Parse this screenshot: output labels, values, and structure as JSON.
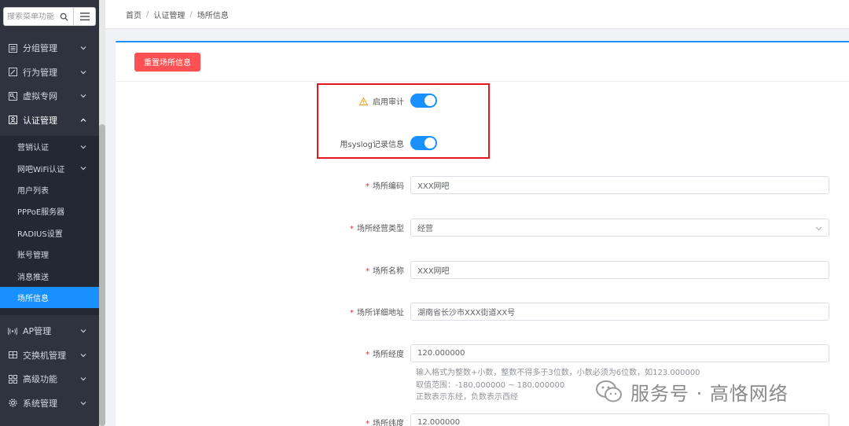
{
  "sidebar": {
    "search_placeholder": "搜索菜单功能",
    "top_items": [
      {
        "label": "分组管理",
        "icon": "list-icon"
      },
      {
        "label": "行为管理",
        "icon": "edit-icon"
      },
      {
        "label": "虚拟专网",
        "icon": "network-icon"
      },
      {
        "label": "认证管理",
        "icon": "id-card-icon",
        "open": true
      }
    ],
    "sub_items": [
      {
        "label": "营销认证",
        "has_children": true
      },
      {
        "label": "网吧WiFi认证",
        "has_children": true
      },
      {
        "label": "用户列表"
      },
      {
        "label": "PPPoE服务器"
      },
      {
        "label": "RADIUS设置"
      },
      {
        "label": "账号管理"
      },
      {
        "label": "消息推送"
      },
      {
        "label": "场所信息",
        "active": true
      }
    ],
    "bottom_items": [
      {
        "label": "AP管理",
        "icon": "wifi-antenna-icon"
      },
      {
        "label": "交换机管理",
        "icon": "switch-icon"
      },
      {
        "label": "高级功能",
        "icon": "grid-icon"
      },
      {
        "label": "系统管理",
        "icon": "gear-icon"
      }
    ]
  },
  "breadcrumb": [
    "首页",
    "认证管理",
    "场所信息"
  ],
  "toolbar": {
    "reset_label": "重置场所信息"
  },
  "form": {
    "audit_label": "启用审计",
    "audit_enabled": true,
    "syslog_label": "用syslog记录信息",
    "syslog_enabled": true,
    "place_code_label": "场所编码",
    "place_code_value": "XXX网吧",
    "business_type_label": "场所经营类型",
    "business_type_value": "经营",
    "place_name_label": "场所名称",
    "place_name_value": "XXX网吧",
    "address_label": "场所详细地址",
    "address_value": "湖南省长沙市XXX街道XX号",
    "longitude_label": "场所经度",
    "longitude_value": "120.000000",
    "longitude_hints": [
      "输入格式为整数+小数，整数不得多于3位数，小数必须为6位数，如123.000000",
      "取值范围：-180.000000 ~ 180.000000",
      "正数表示东经，负数表示西经"
    ],
    "latitude_label": "场所纬度",
    "latitude_value": "12.000000"
  },
  "watermark": {
    "text": "服务号 · 高恪网络"
  },
  "colors": {
    "sidebar_bg": "#2f3340",
    "submenu_bg": "#242833",
    "accent": "#1890ff",
    "danger": "#ff5053",
    "highlight": "#e5161c"
  }
}
